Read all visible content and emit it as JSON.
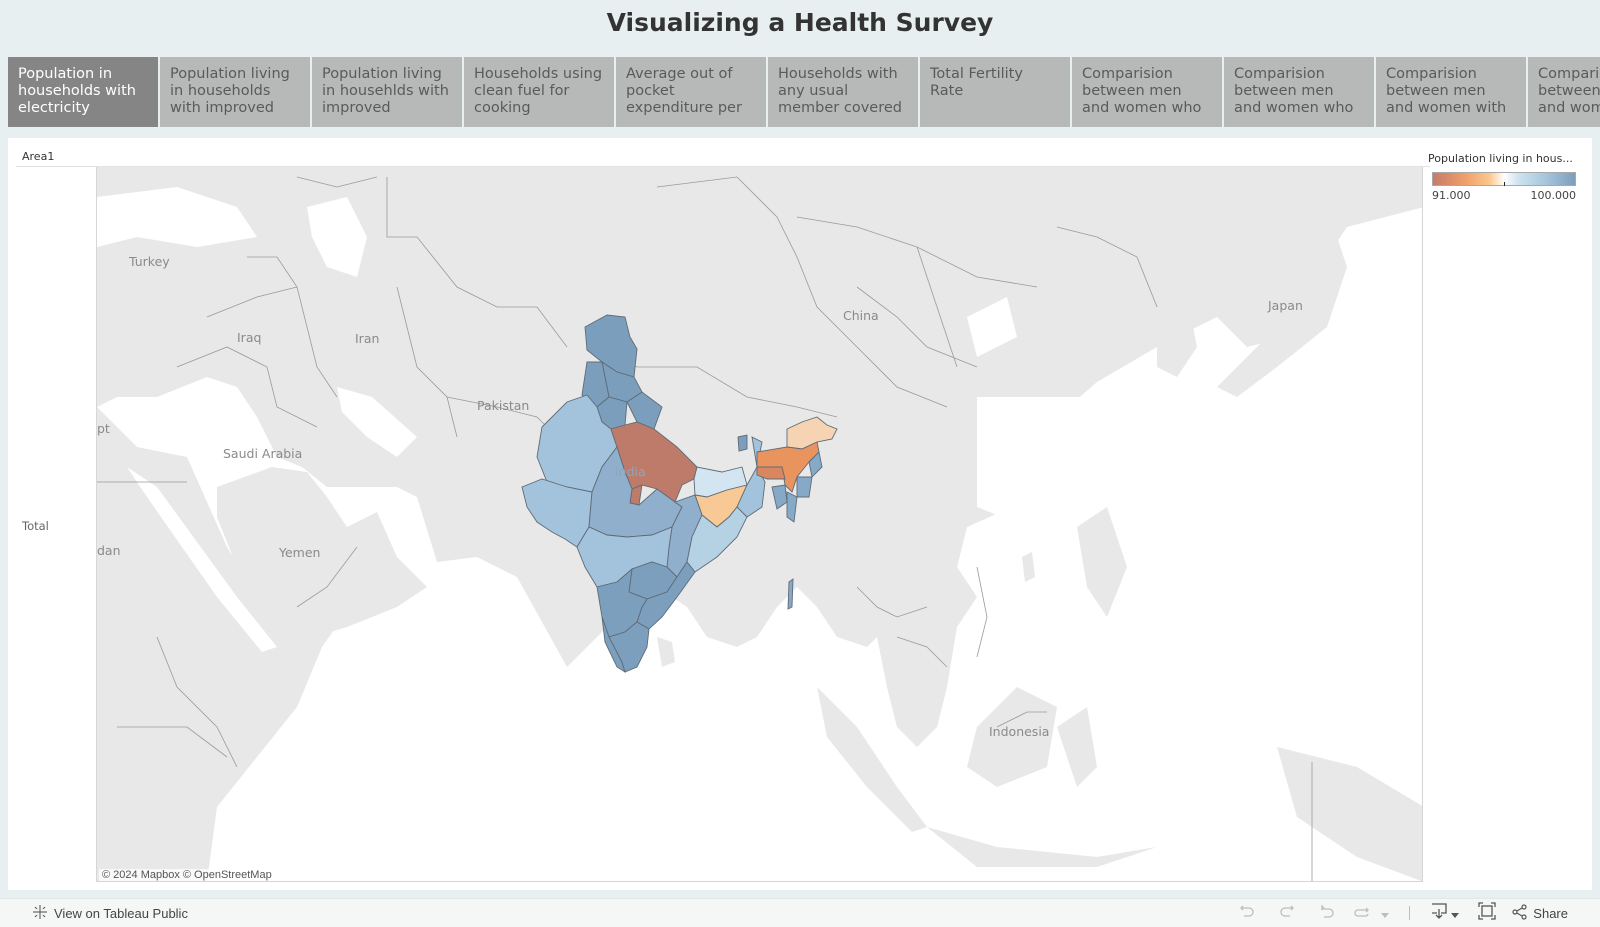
{
  "title": "Visualizing a Health Survey",
  "tabs": [
    {
      "label": "Population in households with electricity",
      "active": true
    },
    {
      "label": "Population living in households with improved",
      "active": false
    },
    {
      "label": "Population living in househlds with improved",
      "active": false
    },
    {
      "label": "Households using clean fuel for cooking",
      "active": false
    },
    {
      "label": "Average out of pocket expenditure per",
      "active": false
    },
    {
      "label": "Households with any usual member covered",
      "active": false
    },
    {
      "label": "Total Fertility Rate",
      "active": false
    },
    {
      "label": "Comparision between men and women who",
      "active": false
    },
    {
      "label": "Comparision between men and women who",
      "active": false
    },
    {
      "label": "Comparision between men and women with",
      "active": false
    },
    {
      "label": "Comparision between men and women",
      "active": false
    }
  ],
  "viz": {
    "column_header": "Area1",
    "row_header": "Total",
    "attribution": "© 2024 Mapbox  © OpenStreetMap",
    "map_labels": {
      "turkey": "Turkey",
      "iraq": "Iraq",
      "iran": "Iran",
      "pakistan": "Pakistan",
      "saudi": "Saudi Arabia",
      "egypt": "pt",
      "sudan": "dan",
      "yemen": "Yemen",
      "india": "India",
      "china": "China",
      "japan": "Japan",
      "indonesia": "Indonesia"
    }
  },
  "legend": {
    "title": "Population living in hous...",
    "min_label": "91.000",
    "max_label": "100.000",
    "min": 91.0,
    "max": 100.0,
    "colors": {
      "low": "#c57c6a",
      "mid_low": "#fcc78e",
      "mid": "#ffffff",
      "mid_high": "#a8c8de",
      "high": "#7d9fbe"
    }
  },
  "states_fill": {
    "north_dark": "#7b9ebd",
    "up": "#bf7b69",
    "bihar": "#d3e5f0",
    "jharkhand": "#f8c994",
    "west_light": "#a3c3dc",
    "central": "#8fafcc",
    "odisha": "#b5d2e5",
    "south_dark": "#7d9fbe",
    "assam": "#e9935f",
    "arunachal": "#f5d3b3",
    "ne_blue": "#87a9c8"
  },
  "footer": {
    "view_link": "View on Tableau Public",
    "share_label": "Share"
  },
  "icons": {
    "tableau": "tableau-logo-icon",
    "undo": "undo-icon",
    "redo": "redo-icon",
    "revert": "revert-icon",
    "refresh": "refresh-icon",
    "download": "download-icon",
    "fullscreen": "fullscreen-icon",
    "share": "share-icon"
  }
}
